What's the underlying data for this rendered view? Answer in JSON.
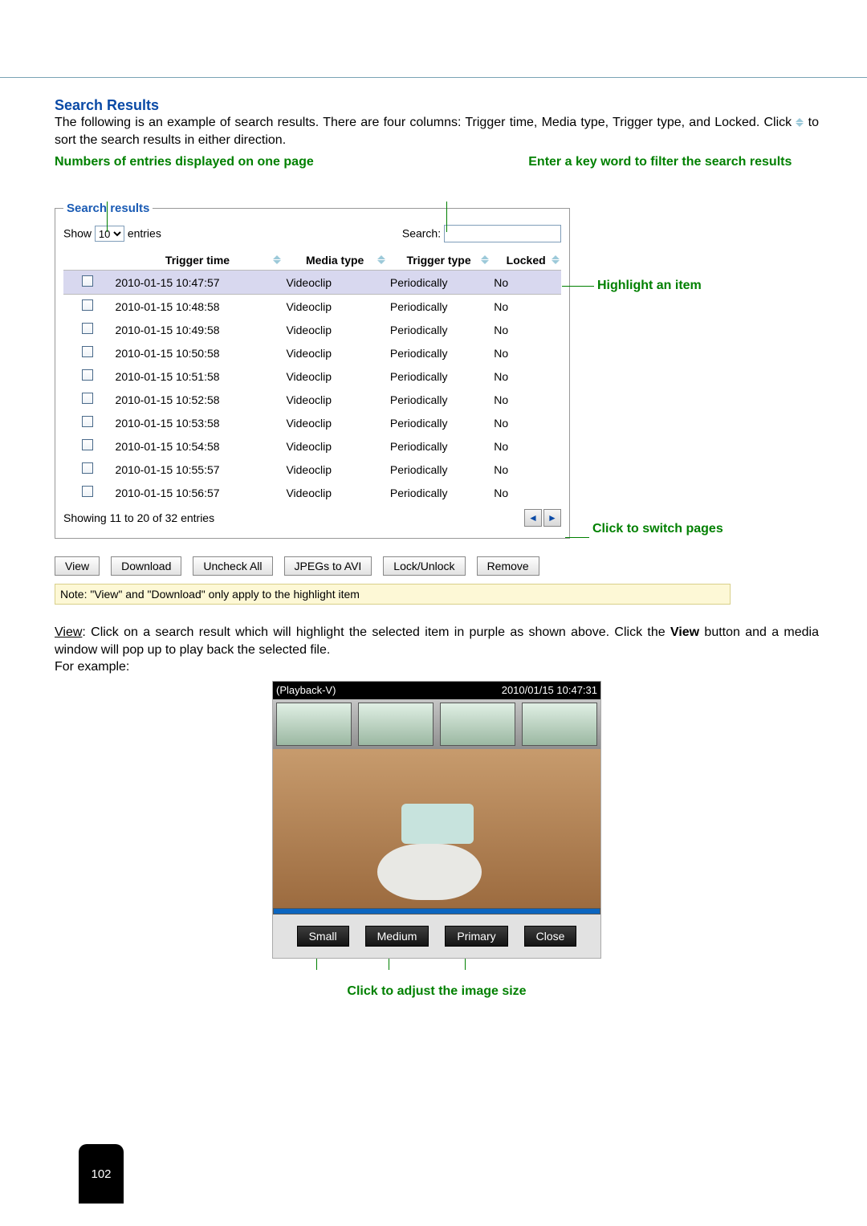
{
  "heading": "Search Results",
  "body1_a": "The following is an example of search results. There are four columns: Trigger time, Media type, Trigger type, and Locked. Click ",
  "body1_b": " to sort the search results in either direction.",
  "ann_left": "Numbers of entries displayed on one page",
  "ann_right": "Enter a key word to filter the search results",
  "fieldset_legend": "Search results",
  "show_label": "Show",
  "entries_label": "entries",
  "page_size_value": "10",
  "search_label": "Search:",
  "columns": {
    "trigger_time": "Trigger time",
    "media_type": "Media type",
    "trigger_type": "Trigger type",
    "locked": "Locked"
  },
  "rows": [
    {
      "t": "2010-01-15 10:47:57",
      "m": "Videoclip",
      "r": "Periodically",
      "l": "No",
      "hl": true
    },
    {
      "t": "2010-01-15 10:48:58",
      "m": "Videoclip",
      "r": "Periodically",
      "l": "No",
      "hl": false
    },
    {
      "t": "2010-01-15 10:49:58",
      "m": "Videoclip",
      "r": "Periodically",
      "l": "No",
      "hl": false
    },
    {
      "t": "2010-01-15 10:50:58",
      "m": "Videoclip",
      "r": "Periodically",
      "l": "No",
      "hl": false
    },
    {
      "t": "2010-01-15 10:51:58",
      "m": "Videoclip",
      "r": "Periodically",
      "l": "No",
      "hl": false
    },
    {
      "t": "2010-01-15 10:52:58",
      "m": "Videoclip",
      "r": "Periodically",
      "l": "No",
      "hl": false
    },
    {
      "t": "2010-01-15 10:53:58",
      "m": "Videoclip",
      "r": "Periodically",
      "l": "No",
      "hl": false
    },
    {
      "t": "2010-01-15 10:54:58",
      "m": "Videoclip",
      "r": "Periodically",
      "l": "No",
      "hl": false
    },
    {
      "t": "2010-01-15 10:55:57",
      "m": "Videoclip",
      "r": "Periodically",
      "l": "No",
      "hl": false
    },
    {
      "t": "2010-01-15 10:56:57",
      "m": "Videoclip",
      "r": "Periodically",
      "l": "No",
      "hl": false
    }
  ],
  "status_text": "Showing 11 to 20 of 32 entries",
  "buttons": {
    "view": "View",
    "download": "Download",
    "uncheck": "Uncheck All",
    "jpeg": "JPEGs to AVI",
    "lock": "Lock/Unlock",
    "remove": "Remove"
  },
  "note": "Note: \"View\" and \"Download\" only apply to the highlight item",
  "ann_highlight": "Highlight an item",
  "ann_pages": "Click to switch pages",
  "para2": {
    "view_u": "View",
    "a": ": Click on a search result which will highlight the selected item in purple as shown above. Click the ",
    "view_b": "View",
    "b": " button and a media window will pop up to play back the selected file.",
    "c": "For example:"
  },
  "player": {
    "label": "(Playback-V)",
    "timestamp": "2010/01/15 10:47:31",
    "small": "Small",
    "medium": "Medium",
    "primary": "Primary",
    "close": "Close"
  },
  "ann_size": "Click to adjust the image size",
  "page_num": "102"
}
